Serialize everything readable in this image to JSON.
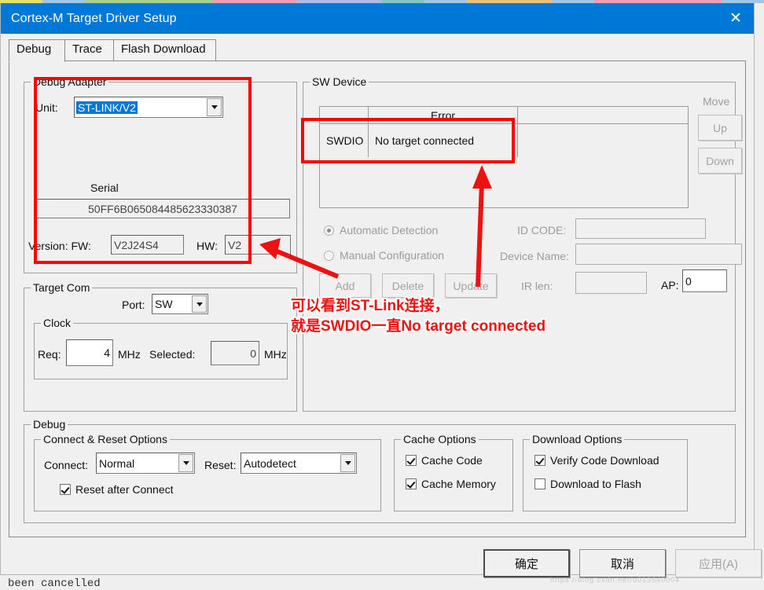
{
  "window": {
    "title": "Cortex-M Target Driver Setup",
    "close_icon": "close-icon",
    "titlebar_color": "#0078d7"
  },
  "background": {
    "text_behind": "been cancelled",
    "strip_colors": [
      "#e8e06a",
      "#9fc7ea",
      "#a8cf8e",
      "#a8cf8e",
      "#a8cf8e",
      "#ec9fb0",
      "#ec9fb0",
      "#b0b8ee",
      "#b0b8ee",
      "#7ec8c0",
      "#9fc7ea",
      "#e8c27a",
      "#e8c27a",
      "#9fc7ea",
      "#ec9fb0",
      "#ec9fb0",
      "#ec9fb0",
      "#9fc7ea"
    ]
  },
  "tabs": [
    {
      "label": "Debug",
      "active": true
    },
    {
      "label": "Trace",
      "active": false
    },
    {
      "label": "Flash Download",
      "active": false
    }
  ],
  "debug_adapter": {
    "legend": "Debug Adapter",
    "unit_label": "Unit:",
    "unit_value": "ST-LINK/V2",
    "serial_label": "Serial",
    "serial_value": "50FF6B065084485623330387",
    "version_label": "Version: FW:",
    "fw_value": "V2J24S4",
    "hw_label": "HW:",
    "hw_value": "V2"
  },
  "target_com": {
    "legend": "Target Com",
    "port_label": "Port:",
    "port_value": "SW",
    "clock": {
      "legend": "Clock",
      "req_label": "Req:",
      "req_value": "4",
      "req_unit": "MHz",
      "selected_label": "Selected:",
      "selected_value": "0",
      "selected_unit": "MHz"
    }
  },
  "sw_device": {
    "legend": "SW Device",
    "columns": [
      "",
      "Error",
      ""
    ],
    "rows": [
      {
        "name": "SWDIO",
        "error": "No target connected",
        "extra": ""
      }
    ],
    "move_label": "Move",
    "up_label": "Up",
    "down_label": "Down",
    "radios": [
      {
        "label": "Automatic Detection",
        "selected": true
      },
      {
        "label": "Manual Configuration",
        "selected": false
      }
    ],
    "buttons": [
      {
        "label": "Add",
        "disabled": true
      },
      {
        "label": "Delete",
        "disabled": true
      },
      {
        "label": "Update",
        "disabled": true
      }
    ],
    "id_code_label": "ID CODE:",
    "id_code_value": "",
    "device_name_label": "Device Name:",
    "device_name_value": "",
    "ir_len_label": "IR len:",
    "ir_len_value": "",
    "ap_label": "AP:",
    "ap_value": "0"
  },
  "debug_section": {
    "legend": "Debug",
    "connect_reset": {
      "legend": "Connect & Reset Options",
      "connect_label": "Connect:",
      "connect_value": "Normal",
      "reset_label": "Reset:",
      "reset_value": "Autodetect",
      "reset_after_connect_label": "Reset after Connect",
      "reset_after_connect_checked": true
    },
    "cache_options": {
      "legend": "Cache Options",
      "items": [
        {
          "label": "Cache Code",
          "checked": true
        },
        {
          "label": "Cache Memory",
          "checked": true
        }
      ]
    },
    "download_options": {
      "legend": "Download Options",
      "items": [
        {
          "label": "Verify Code Download",
          "checked": true
        },
        {
          "label": "Download to Flash",
          "checked": false
        }
      ]
    }
  },
  "footer": {
    "ok_label": "确定",
    "cancel_label": "取消",
    "apply_label": "应用(A)",
    "apply_disabled": true
  },
  "annotations": {
    "line1": "可以看到ST-Link连接，",
    "line2": "就是SWDIO一直No target connected",
    "color": "#ee1111",
    "boxes": 2,
    "arrows": 2
  },
  "watermark": "https://blog.csdn.net/u013640004"
}
